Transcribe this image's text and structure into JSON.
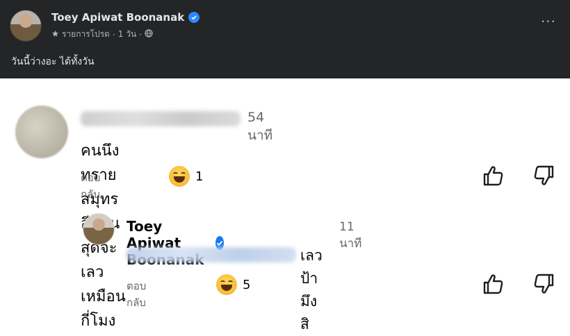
{
  "post": {
    "author": "Toey Apiwat Boonanak",
    "meta_audience": "รายการโปรด",
    "meta_time": "1 วัน",
    "meta_separator": "·",
    "text": "วันนี้ว่างอะ ได้ทั้งวัน",
    "more_label": "···"
  },
  "comments": [
    {
      "time": "54 นาที",
      "text": "คนนึงทรายสมุทร อีกคนสุดจะเลว เหมือนกี่โมง",
      "reply_label": "ตอบกลับ",
      "reaction_count": "1",
      "reaction_icon": "haha-icon"
    },
    {
      "author": "Toey Apiwat Boonanak",
      "time": "11 นาที",
      "text": "เลวป้ามึงสิ",
      "reply_label": "ตอบกลับ",
      "reaction_count": "5",
      "reaction_icon": "haha-icon"
    }
  ],
  "colors": {
    "post_bg": "#242526",
    "verified": "#1877f2",
    "secondary_text": "#65676b"
  }
}
